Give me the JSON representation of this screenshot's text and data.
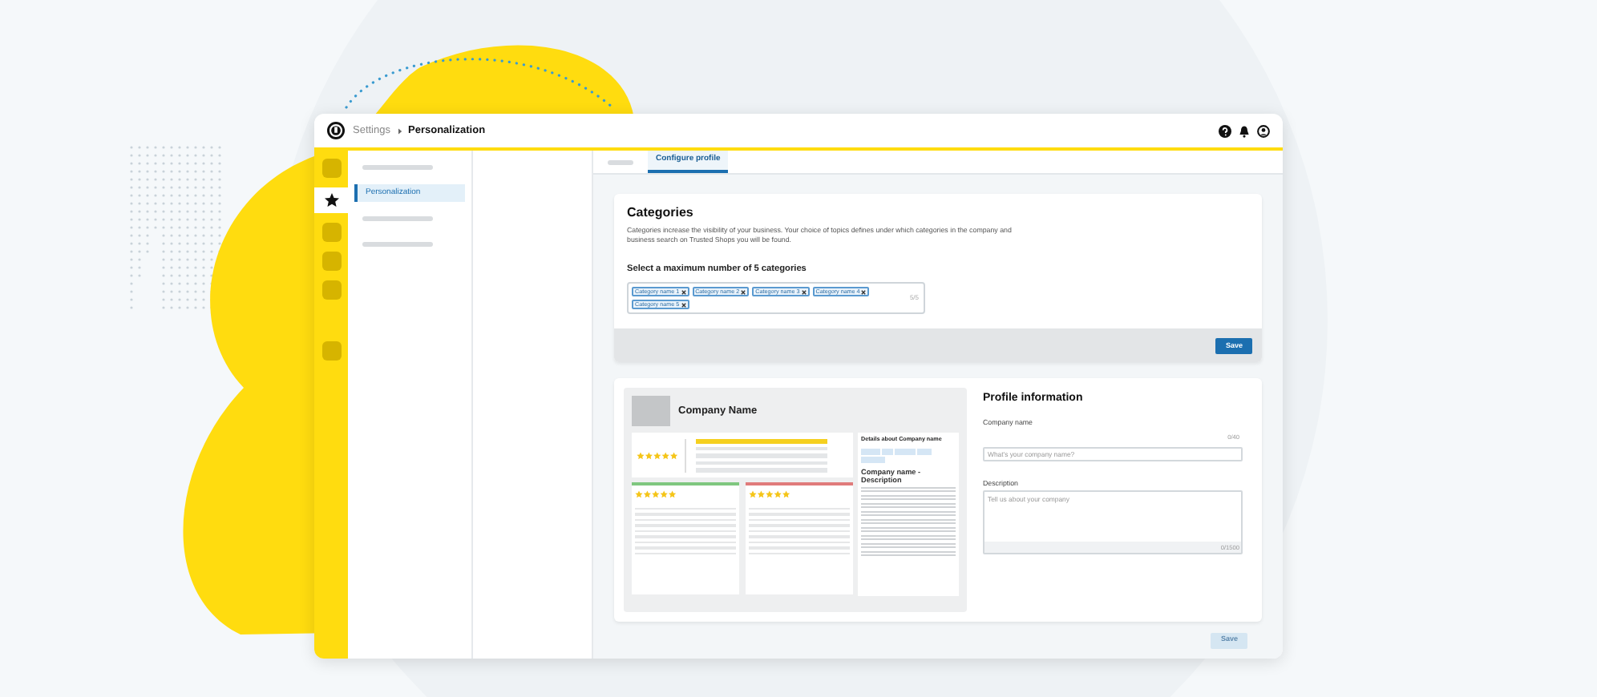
{
  "header": {
    "breadcrumb": [
      {
        "label": "Settings",
        "current": false
      },
      {
        "label": "Personalization",
        "current": true
      }
    ]
  },
  "rail": [
    {
      "selected": false
    },
    {
      "selected": true
    },
    {
      "selected": false
    },
    {
      "selected": false
    },
    {
      "selected": false
    },
    {
      "selected": false
    }
  ],
  "nav": [
    {
      "kind": "skeleton",
      "selected": false
    },
    {
      "kind": "link",
      "label": "Personalization",
      "selected": true
    },
    {
      "kind": "skeleton",
      "selected": false
    },
    {
      "kind": "skeleton",
      "selected": false
    }
  ],
  "tabs": [
    {
      "kind": "skeleton",
      "selected": false
    },
    {
      "kind": "label",
      "label": "Configure profile",
      "selected": true
    }
  ],
  "categories": {
    "title": "Categories",
    "description": "Categories increase the visibility of your business. Your choice of topics defines under which categories in the company and business search on Trusted Shops you will be found.",
    "select_label": "Select a maximum number of 5 categories",
    "chips": [
      "Category name 1",
      "Category name 2",
      "Category name 3",
      "Category name 4",
      "Category name 5"
    ],
    "count": "5/5",
    "save_label": "Save"
  },
  "preview": {
    "company_name": "Company Name",
    "rating_bars": [
      {
        "level": 1
      },
      {
        "level": 0
      },
      {
        "level": 0
      },
      {
        "level": 0
      },
      {
        "level": 0
      }
    ],
    "details_title": "Details about Company name",
    "description_title": "Company name - Description",
    "reviews": [
      {
        "color": "#7fc77f"
      },
      {
        "color": "#e07b7b"
      }
    ]
  },
  "profile": {
    "title": "Profile information",
    "fields": [
      {
        "kind": "input",
        "label": "Company name",
        "placeholder": "What's your company name?",
        "counter": "0/40"
      },
      {
        "kind": "textarea",
        "label": "Description",
        "placeholder": "Tell us about your company",
        "counter": "0/1500"
      }
    ]
  },
  "footer": {
    "save_label": "Save",
    "disabled": true
  }
}
